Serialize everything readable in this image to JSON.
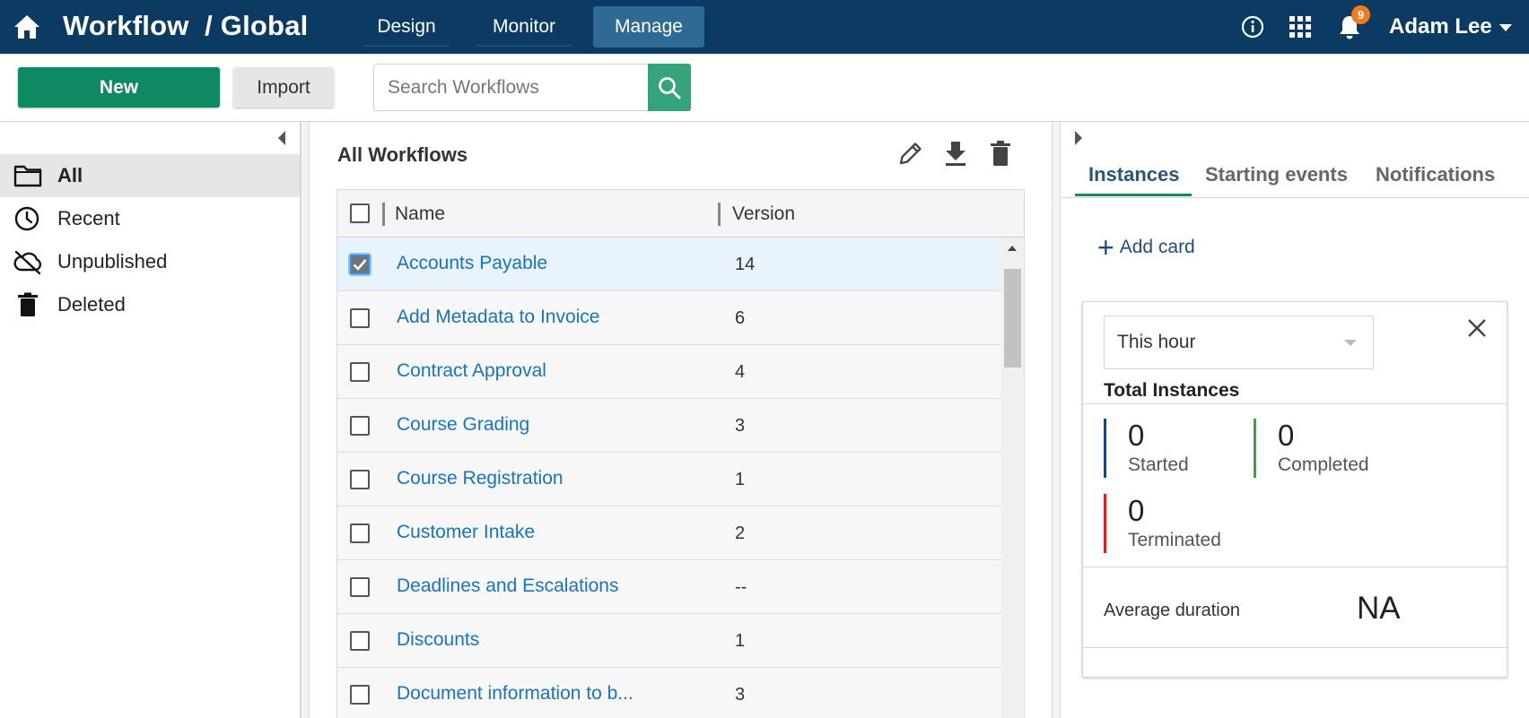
{
  "topbar": {
    "app_title": "Workflow",
    "scope": "/ Global",
    "nav": [
      {
        "label": "Design"
      },
      {
        "label": "Monitor"
      },
      {
        "label": "Manage"
      }
    ],
    "notification_count": "9",
    "user_name": "Adam Lee"
  },
  "toolbar": {
    "new_label": "New",
    "import_label": "Import",
    "search_placeholder": "Search Workflows"
  },
  "sidebar": {
    "items": [
      {
        "label": "All",
        "icon": "folder-icon",
        "active": true
      },
      {
        "label": "Recent",
        "icon": "clock-icon"
      },
      {
        "label": "Unpublished",
        "icon": "cloud-off-icon"
      },
      {
        "label": "Deleted",
        "icon": "trash-icon"
      }
    ]
  },
  "center": {
    "title": "All Workflows",
    "columns": [
      "Name",
      "Version"
    ],
    "rows": [
      {
        "name": "Accounts Payable",
        "version": "14",
        "selected": true
      },
      {
        "name": "Add Metadata to Invoice",
        "version": "6"
      },
      {
        "name": "Contract Approval",
        "version": "4"
      },
      {
        "name": "Course Grading",
        "version": "3"
      },
      {
        "name": "Course Registration",
        "version": "1"
      },
      {
        "name": "Customer Intake",
        "version": "2"
      },
      {
        "name": "Deadlines and Escalations",
        "version": "--"
      },
      {
        "name": "Discounts",
        "version": "1"
      },
      {
        "name": "Document information to b...",
        "version": "3"
      }
    ]
  },
  "right": {
    "tabs": [
      {
        "label": "Instances",
        "active": true
      },
      {
        "label": "Starting events"
      },
      {
        "label": "Notifications"
      }
    ],
    "add_card_label": "Add card",
    "card": {
      "period": "This hour",
      "title": "Total Instances",
      "stats": [
        {
          "value": "0",
          "label": "Started",
          "color": "#1f3f8f"
        },
        {
          "value": "0",
          "label": "Completed",
          "color": "#3aa63a"
        },
        {
          "value": "0",
          "label": "Terminated",
          "color": "#e02020"
        }
      ],
      "avg_label": "Average duration",
      "avg_value": "NA"
    }
  },
  "colors": {
    "topbar_bg": "#0b3b63",
    "primary_button": "#0d8a63",
    "search_button": "#35a47b",
    "link": "#1a73c0",
    "badge": "#f07c1a"
  }
}
